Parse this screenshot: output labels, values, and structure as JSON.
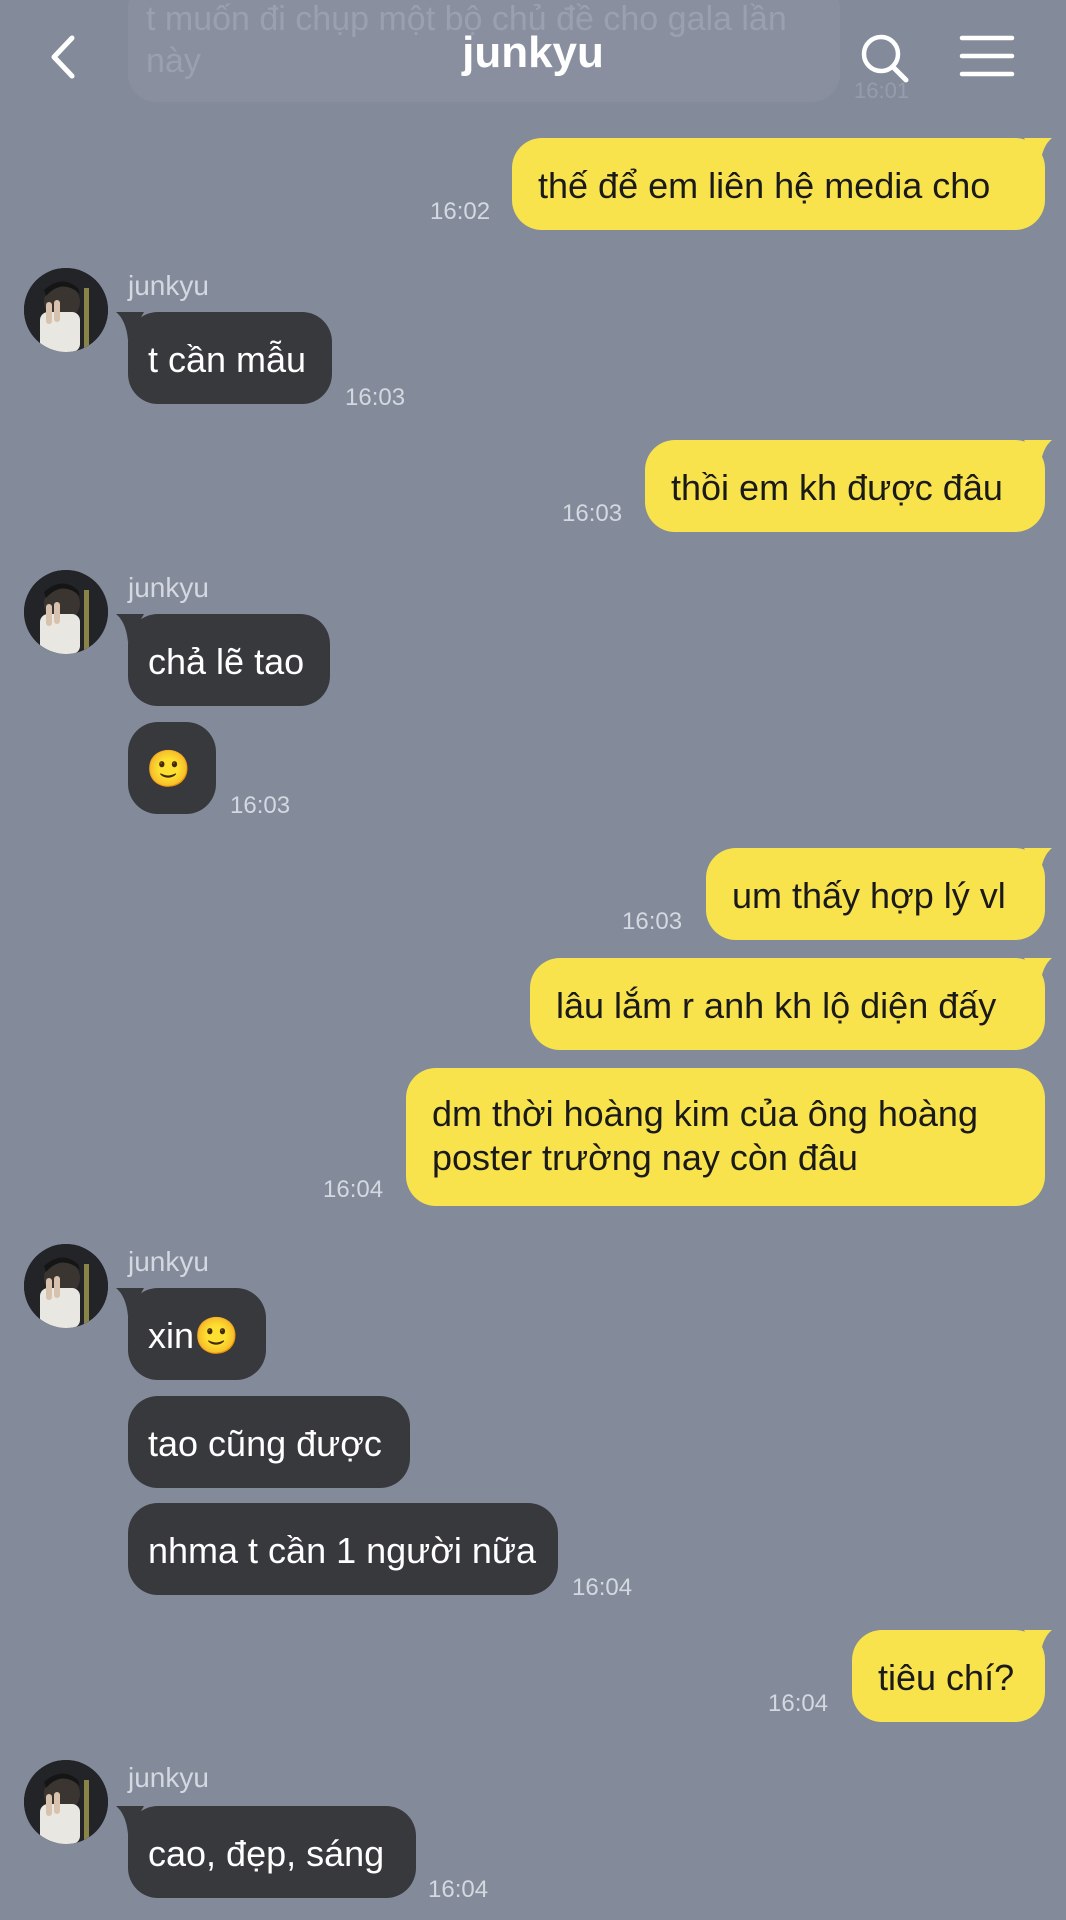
{
  "header": {
    "title": "junkyu",
    "back_icon": "chevron-left-icon",
    "search_icon": "search-icon",
    "menu_icon": "hamburger-menu-icon"
  },
  "colors": {
    "background": "#838A9A",
    "outgoing_bubble": "#F8E34C",
    "incoming_bubble": "#38393D",
    "timestamp": "#D4D8E0"
  },
  "previous_message": {
    "text": "t muốn đi chụp một bộ chủ đề cho gala lần này",
    "time": "16:01"
  },
  "messages": [
    {
      "from": "me",
      "text": "thế để em liên hệ media cho",
      "time": "16:02"
    },
    {
      "from": "junkyu",
      "sender": "junkyu",
      "text": "t cần mẫu",
      "time": "16:03"
    },
    {
      "from": "me",
      "text": "thồi em kh được đâu",
      "time": "16:03"
    },
    {
      "from": "junkyu",
      "sender": "junkyu",
      "text": "chả lẽ tao"
    },
    {
      "from": "junkyu",
      "text": "🙂",
      "time": "16:03"
    },
    {
      "from": "me",
      "text": "um thấy hợp lý vl",
      "time": "16:03"
    },
    {
      "from": "me",
      "text": "lâu lắm r anh kh lộ diện đấy"
    },
    {
      "from": "me",
      "text_line1": "dm thời hoàng kim của ông hoàng",
      "text_line2": "poster trường nay còn đâu",
      "time": "16:04"
    },
    {
      "from": "junkyu",
      "sender": "junkyu",
      "text": "xin🙂"
    },
    {
      "from": "junkyu",
      "text": "tao cũng được"
    },
    {
      "from": "junkyu",
      "text": "nhma t cần 1 người nữa",
      "time": "16:04"
    },
    {
      "from": "me",
      "text": "tiêu chí?",
      "time": "16:04"
    },
    {
      "from": "junkyu",
      "sender": "junkyu",
      "text": "cao, đẹp, sáng",
      "time": "16:04"
    }
  ]
}
